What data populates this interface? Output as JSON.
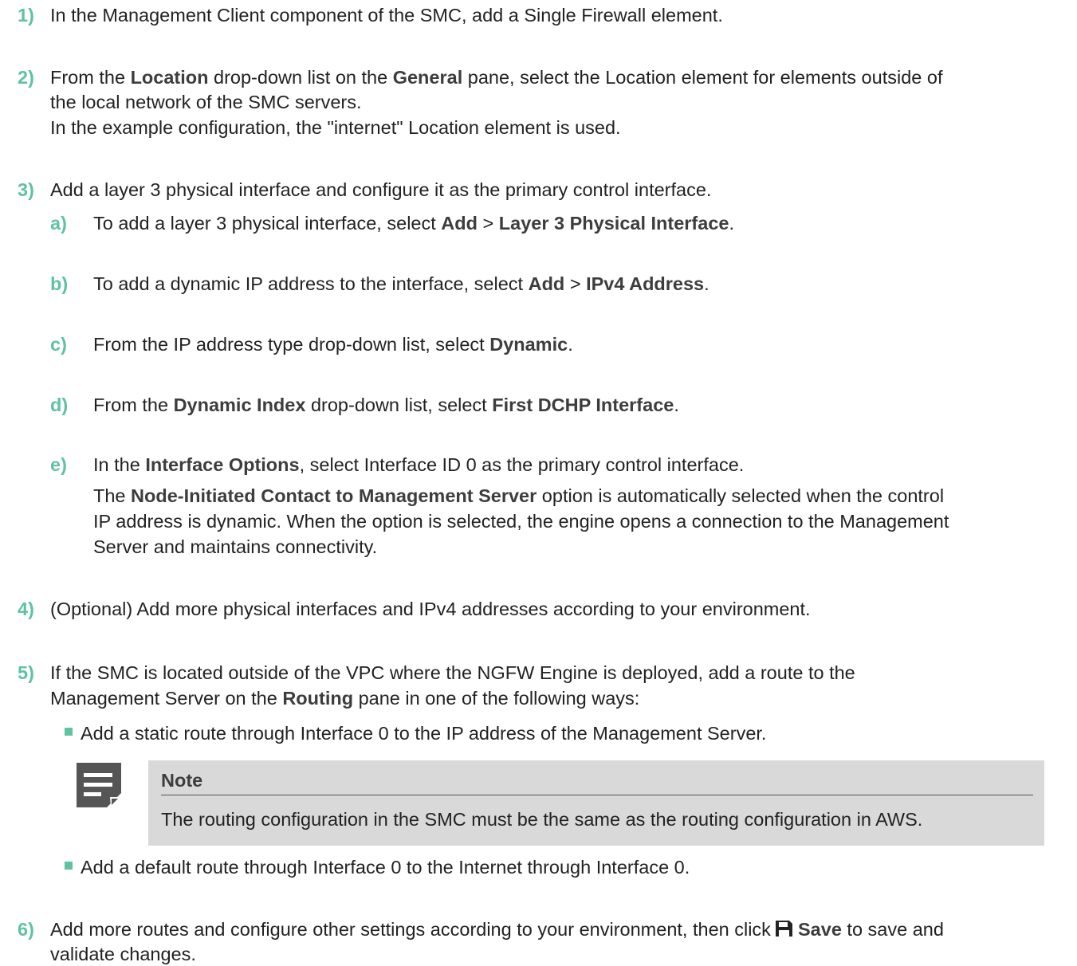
{
  "steps": [
    {
      "num": "1)",
      "text": "In the Management Client component of the SMC, add a Single Firewall element."
    },
    {
      "num": "2)",
      "line1": {
        "a": "From the ",
        "b1": "Location",
        "c": " drop-down list on the ",
        "b2": "General",
        "d": " pane, select the Location element for elements outside of"
      },
      "line2": "the local network of the SMC servers.",
      "line3": "In the example configuration, the \"internet\" Location element is used."
    },
    {
      "num": "3)",
      "text": "Add a layer 3 physical interface and configure it as the primary control interface.",
      "substeps": [
        {
          "num": "a)",
          "a": "To add a layer 3 physical interface, select ",
          "b1": "Add",
          "sep": " > ",
          "b2": "Layer 3 Physical Interface",
          "end": "."
        },
        {
          "num": "b)",
          "a": "To add a dynamic IP address to the interface, select ",
          "b1": "Add",
          "sep": " > ",
          "b2": "IPv4 Address",
          "end": "."
        },
        {
          "num": "c)",
          "a": "From the IP address type drop-down list, select ",
          "b1": "Dynamic",
          "end": "."
        },
        {
          "num": "d)",
          "a": "From the ",
          "b1": "Dynamic Index",
          "mid": " drop-down list, select ",
          "b2": "First DCHP Interface",
          "end": "."
        },
        {
          "num": "e)",
          "a": "In the ",
          "b1": "Interface Options",
          "end": ", select Interface ID 0 as the primary control interface.",
          "p_a": "The ",
          "p_b": "Node-Initiated Contact to Management Server",
          "p_c": " option is automatically selected when the control",
          "p_line2": "IP address is dynamic. When the option is selected, the engine opens a connection to the Management",
          "p_line3": "Server and maintains connectivity."
        }
      ]
    },
    {
      "num": "4)",
      "text": "(Optional) Add more physical interfaces and IPv4 addresses according to your environment."
    },
    {
      "num": "5)",
      "line1": "If the SMC is located outside of the VPC where the NGFW Engine is deployed, add a route to the",
      "line2": {
        "a": "Management Server on the ",
        "b": "Routing",
        "c": " pane in one of the following ways:"
      },
      "bullets": [
        "Add a static route through Interface 0 to the IP address of the Management Server.",
        "Add a default route through Interface 0 to the Internet through Interface 0."
      ],
      "note": {
        "title": "Note",
        "text": "The routing configuration in the SMC must be the same as the routing configuration in AWS."
      }
    },
    {
      "num": "6)",
      "line1": {
        "a": "Add more routes and configure other settings according to your environment, then click ",
        "b": "Save",
        "c": " to save and"
      },
      "line2": "validate changes."
    }
  ],
  "icons": {
    "note": "note-icon",
    "save": "save-icon"
  },
  "colors": {
    "accent": "#5fc2a2",
    "text": "#222222",
    "bold": "#3d3d3d",
    "note_bg": "#d9d9d9",
    "icon": "#555555"
  }
}
